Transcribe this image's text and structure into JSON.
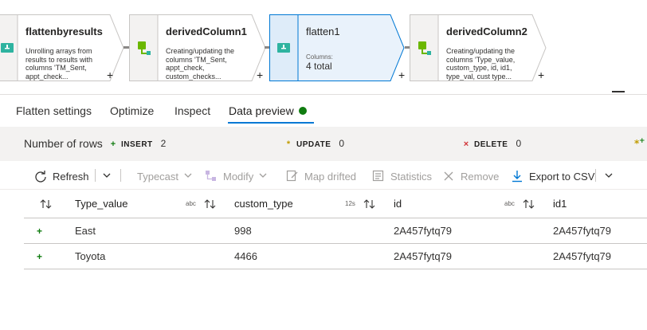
{
  "pipeline": {
    "nodes": [
      {
        "title": "flattenbyresults",
        "description": "Unrolling arrays from results to results with columns 'TM_Sent, appt_check..."
      },
      {
        "title": "derivedColumn1",
        "description": "Creating/updating the columns 'TM_Sent, appt_check, custom_checks..."
      },
      {
        "title": "flatten1",
        "columns_label": "Columns:",
        "columns_value": "4 total"
      },
      {
        "title": "derivedColumn2",
        "description": "Creating/updating the columns 'Type_value, custom_type, id, id1, type_val, cust type..."
      }
    ],
    "add_symbol": "+"
  },
  "tabs": [
    {
      "label": "Flatten settings"
    },
    {
      "label": "Optimize"
    },
    {
      "label": "Inspect"
    },
    {
      "label": "Data preview",
      "active": true
    }
  ],
  "summary": {
    "label": "Number of rows",
    "insert": {
      "glyph": "+",
      "name": "INSERT",
      "value": "2",
      "color": "#107c10"
    },
    "update": {
      "glyph": "*",
      "name": "UPDATE",
      "value": "0",
      "color": "#c19c00"
    },
    "delete": {
      "glyph": "×",
      "name": "DELETE",
      "value": "0",
      "color": "#d13438"
    }
  },
  "toolbar": {
    "refresh": "Refresh",
    "typecast": "Typecast",
    "modify": "Modify",
    "map_drifted": "Map drifted",
    "statistics": "Statistics",
    "remove": "Remove",
    "export": "Export to CSV"
  },
  "table": {
    "columns": [
      {
        "name": "Type_value",
        "dtype": "abc"
      },
      {
        "name": "custom_type",
        "dtype": "12s"
      },
      {
        "name": "id",
        "dtype": "abc"
      },
      {
        "name": "id1",
        "dtype": ""
      }
    ],
    "rows": [
      {
        "marker": "+",
        "cells": [
          "East",
          "998",
          "2A457fytq79",
          "2A457fytq79"
        ]
      },
      {
        "marker": "+",
        "cells": [
          "Toyota",
          "4466",
          "2A457fytq79",
          "2A457fytq79"
        ]
      }
    ]
  },
  "colors": {
    "accent": "#0078d4",
    "success": "#107c10",
    "selected_node_fill": "#e9f2fb",
    "selected_node_border": "#0078d4"
  }
}
